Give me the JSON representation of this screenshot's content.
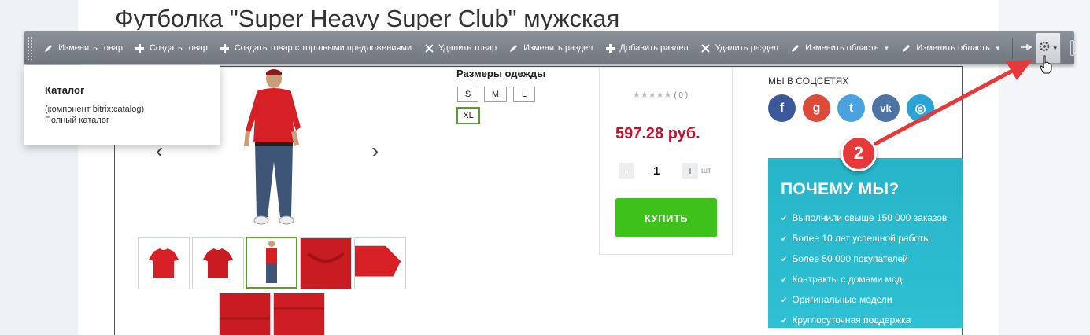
{
  "product": {
    "title": "Футболка \"Super Heavy Super Club\" мужская",
    "sizes_label": "Размеры одежды",
    "sizes": [
      "S",
      "M",
      "L",
      "XL"
    ],
    "selected_size": "XL",
    "rating_count": "( 0 )",
    "price": "597.28 руб.",
    "quantity": "1",
    "unit": "шт",
    "buy_label": "КУПИТЬ"
  },
  "toolbar": {
    "items": [
      {
        "label": "Изменить товар",
        "icon": "pencil-icon"
      },
      {
        "label": "Создать товар",
        "icon": "plus-icon"
      },
      {
        "label": "Создать товар с торговыми предложениями",
        "icon": "plus-icon"
      },
      {
        "label": "Удалить товар",
        "icon": "close-icon"
      },
      {
        "label": "Изменить раздел",
        "icon": "pencil-icon"
      },
      {
        "label": "Добавить раздел",
        "icon": "plus-icon"
      },
      {
        "label": "Удалить раздел",
        "icon": "close-icon"
      },
      {
        "label": "Изменить область",
        "icon": "pencil-icon"
      },
      {
        "label": "Изменить область",
        "icon": "pencil-icon"
      }
    ]
  },
  "tooltip": {
    "title": "Каталог",
    "component": "(компонент bitrix:catalog)",
    "description": "Полный каталог"
  },
  "social": {
    "title": "МЫ В СОЦСЕТЯХ",
    "networks": [
      {
        "name": "facebook-icon",
        "glyph": "f",
        "color": "#3b5998"
      },
      {
        "name": "google-plus-icon",
        "glyph": "g",
        "color": "#dc4a38"
      },
      {
        "name": "twitter-icon",
        "glyph": "t",
        "color": "#4aa3df"
      },
      {
        "name": "vk-icon",
        "glyph": "vk",
        "color": "#4c75a3"
      },
      {
        "name": "instagram-icon",
        "glyph": "◎",
        "color": "#2aa3d6"
      }
    ]
  },
  "why_us": {
    "title": "ПОЧЕМУ МЫ?",
    "items": [
      "Выполнили свыше 150 000 заказов",
      "Более 10 лет успешной работы",
      "Более 50 000 покупателей",
      "Контракты с домами мод",
      "Оригинальные модели",
      "Круглосуточная поддержка"
    ]
  },
  "annotation": {
    "badge": "2"
  },
  "colors": {
    "toolbar": "#7a8189",
    "price": "#c41230",
    "buy": "#3ec11b",
    "why_bg": "#2ec0d4",
    "annotation": "#e5393b"
  }
}
